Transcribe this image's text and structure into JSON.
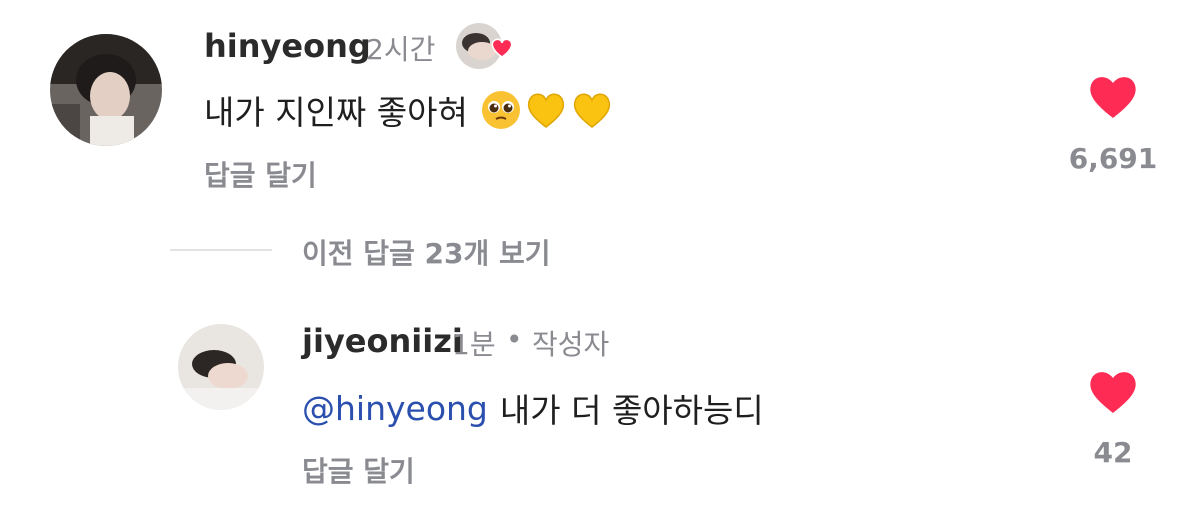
{
  "comments": [
    {
      "username": "hinyeong",
      "time": "2시간",
      "text": "내가 지인짜 좋아혀",
      "emojis": [
        "pleading-face-emoji",
        "yellow-heart-emoji",
        "yellow-heart-emoji"
      ],
      "reply_label": "답글 달기",
      "like_count": "6,691",
      "like_color": "#fe2c55"
    }
  ],
  "view_replies": "이전 답글 23개 보기",
  "replies": [
    {
      "username": "jiyeoniizi",
      "time": "1분",
      "separator": "•",
      "author_tag": "작성자",
      "mention": "@hinyeong",
      "text": "내가 더 좋아하능디",
      "reply_label": "답글 달기",
      "like_count": "42",
      "like_color": "#fe2c55"
    }
  ],
  "colors": {
    "mention": "#2b4fae",
    "muted": "#8a8b91",
    "heart": "#fe2c55"
  }
}
